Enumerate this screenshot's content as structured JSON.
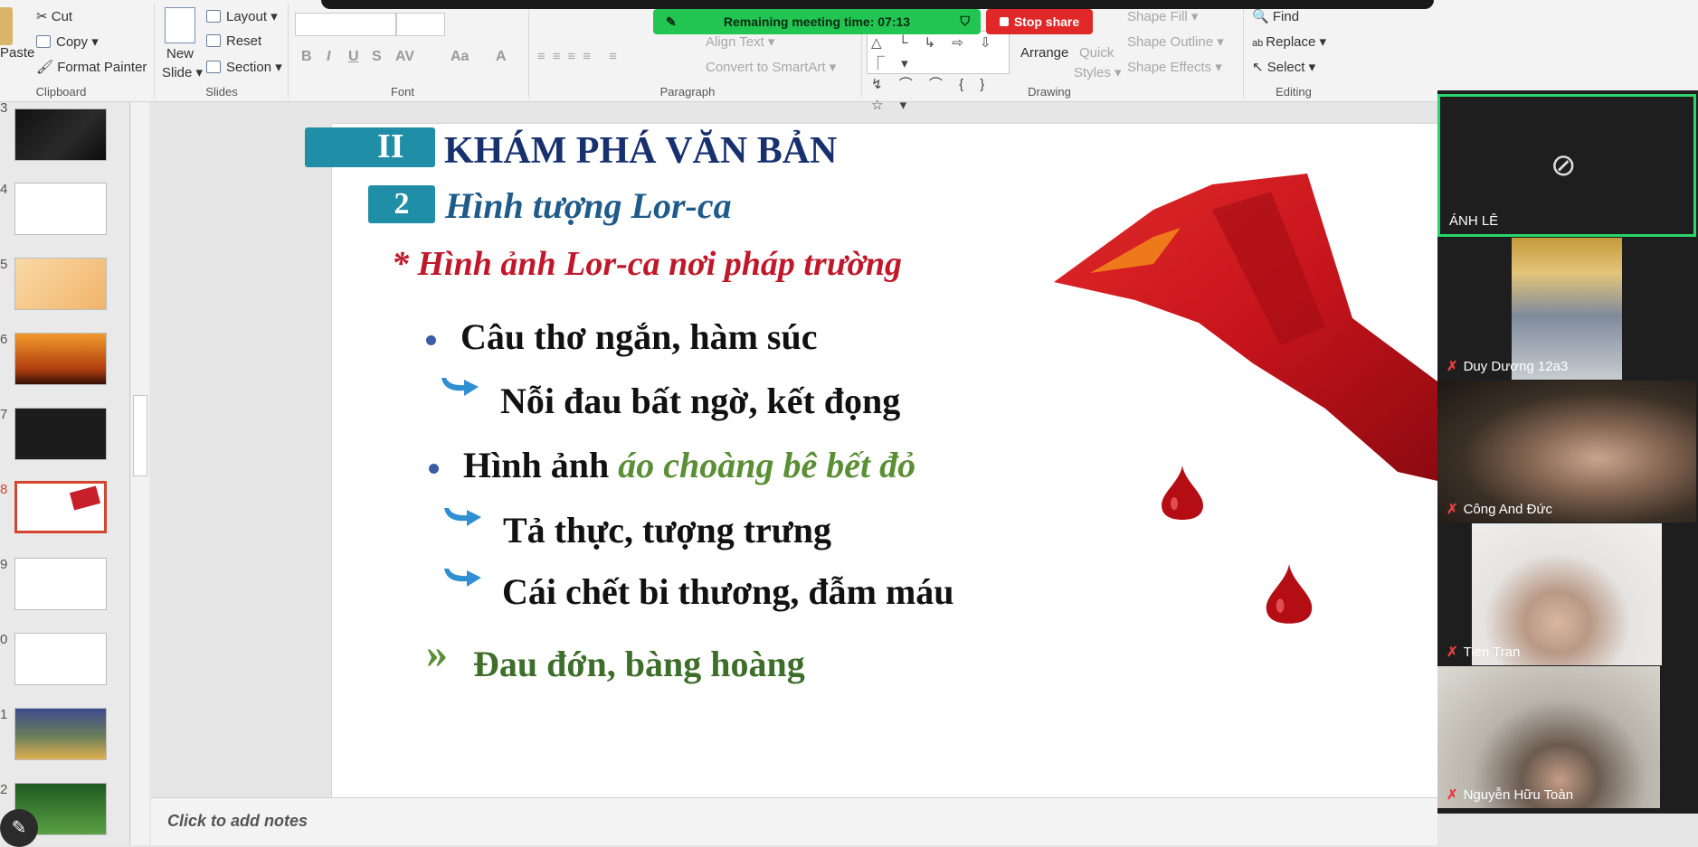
{
  "meeting": {
    "timer_text": "Remaining meeting time: 07:13",
    "stop_share": "Stop share"
  },
  "ribbon": {
    "clipboard": {
      "paste": "Paste",
      "cut": "Cut",
      "copy": "Copy",
      "format_painter": "Format Painter",
      "label": "Clipboard"
    },
    "slides": {
      "new_slide_1": "New",
      "new_slide_2": "Slide",
      "layout": "Layout",
      "reset": "Reset",
      "section": "Section",
      "label": "Slides"
    },
    "font": {
      "label": "Font",
      "bold": "B",
      "italic": "I",
      "underline": "U",
      "shadow": "S",
      "spacing": "AV",
      "case": "Aa",
      "color": "A"
    },
    "paragraph": {
      "align_text": "Align Text",
      "smartart": "Convert to SmartArt",
      "label": "Paragraph"
    },
    "drawing": {
      "arrange": "Arrange",
      "quick_styles_1": "Quick",
      "quick_styles_2": "Styles",
      "shape_fill": "Shape Fill",
      "shape_outline": "Shape Outline",
      "shape_effects": "Shape Effects",
      "label": "Drawing",
      "shapes_row1": "△ └ ↳ ⇨ ⇩ ⎾ ▾",
      "shapes_row2": "↯ ⌒ ⌒ { } ☆ ▾"
    },
    "editing": {
      "find": "Find",
      "replace": "Replace",
      "select": "Select",
      "label": "Editing"
    }
  },
  "thumbnails": {
    "numbers": [
      "3",
      "4",
      "5",
      "6",
      "7",
      "8",
      "9",
      "0",
      "1",
      "2"
    ],
    "active_index": 5
  },
  "slide": {
    "roman": "II",
    "title": "KHÁM PHÁ VĂN BẢN",
    "sub_num": "2",
    "subtitle": "Hình tượng Lor-ca",
    "section_heading": "* Hình ảnh Lor-ca nơi pháp trường",
    "bullet1": "Câu thơ ngắn, hàm súc",
    "arrow1": "Nỗi đau bất ngờ, kết đọng",
    "bullet2_plain": "Hình ảnh ",
    "bullet2_accent": "áo choàng bê bết đỏ",
    "arrow2": "Tả thực, tượng trưng",
    "arrow3": "Cái chết bi thương, đẫm máu",
    "conclusion_mark": "»",
    "conclusion": "Đau đớn, bàng hoàng"
  },
  "notes_placeholder": "Click to add notes",
  "participants": [
    {
      "name": "ÁNH LÊ",
      "video": false
    },
    {
      "name": "Duy Dương 12a3",
      "video": true
    },
    {
      "name": "Công And Đức",
      "video": true
    },
    {
      "name": "Tien Tran",
      "video": true
    },
    {
      "name": "Nguyễn Hữu Toàn",
      "video": true
    }
  ],
  "colors": {
    "timer_green": "#23c552",
    "stop_red": "#e02828",
    "heading_navy": "#17306e",
    "subtitle_blue": "#1f5b8a",
    "red_heading": "#c0182a",
    "accent_green": "#5a8f35",
    "active_thumb": "#d1462d"
  },
  "icons": [
    "cut-icon",
    "copy-icon",
    "format-painter-icon",
    "paste-icon",
    "find-icon",
    "replace-icon",
    "select-icon",
    "camera-off-icon",
    "mic-muted-icon",
    "pencil-icon",
    "shield-check-icon",
    "drag-handle-icon"
  ]
}
